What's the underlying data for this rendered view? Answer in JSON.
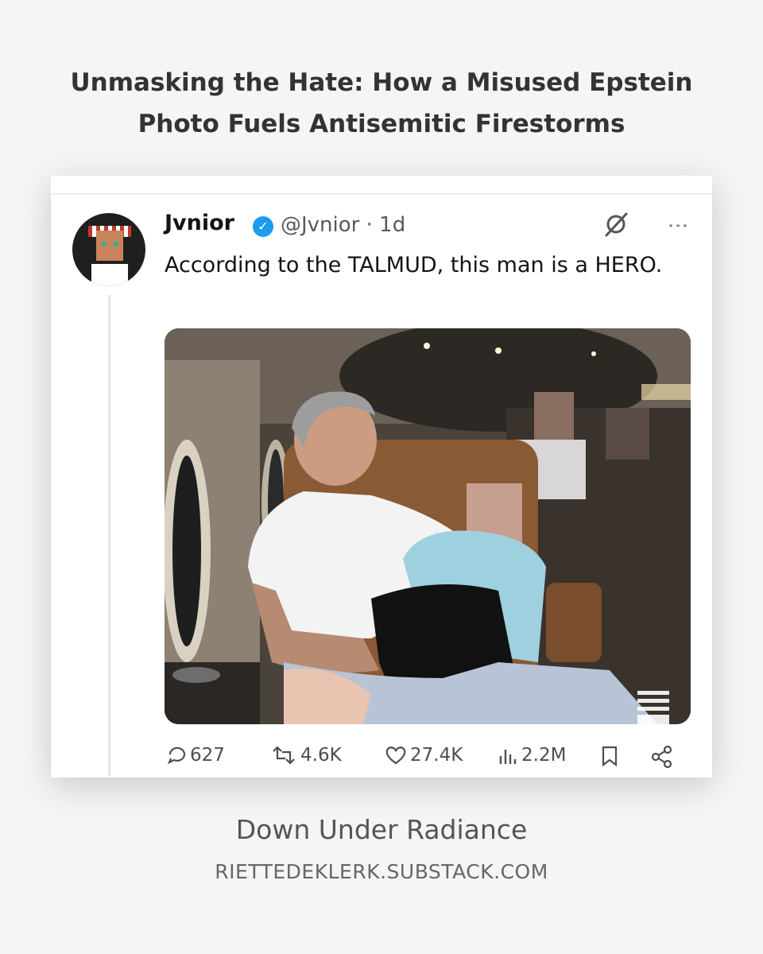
{
  "headline": {
    "line1": "Unmasking the Hate: How a Misused Epstein",
    "line2": "Photo Fuels Antisemitic Firestorms"
  },
  "tweet": {
    "display_name": "Jvnior",
    "handle_time": "@Jvnior · 1d",
    "text": "According to the TALMUD, this man is a HERO.",
    "replies": "627",
    "reposts": "4.6K",
    "likes": "27.4K",
    "views": "2.2M"
  },
  "publication": {
    "name": "Down Under Radiance",
    "url": "RIETTEDEKLERK.SUBSTACK.COM"
  },
  "colors": {
    "background": "#f5f5f5",
    "verified_badge": "#1d9bf0",
    "headline_text": "#333333"
  }
}
